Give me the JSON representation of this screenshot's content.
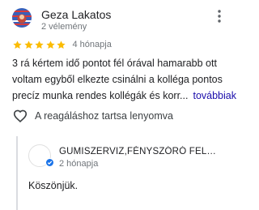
{
  "author": {
    "name": "Geza Lakatos",
    "meta": "2 vélemény"
  },
  "rating": {
    "stars": 5,
    "max": 5,
    "date": "4 hónapja",
    "star_color": "#fbbc04"
  },
  "review": {
    "lines": [
      "3 rá kértem idő pontot fél órával hamarabb ott",
      "voltam egyből elkezte csinálni a kolléga pontos",
      "precíz munka rendes kollégák és korr..."
    ],
    "more_label": "továbbiak"
  },
  "like": {
    "label": "A reagáláshoz tartsa lenyomva"
  },
  "owner_reply": {
    "name": "GUMISZERVIZ,FÉNYSZÓRÓ FEL…",
    "meta": "2 hónapja",
    "text": "Köszönjük."
  },
  "colors": {
    "link": "#1a0dab",
    "verified": "#1a73e8"
  }
}
